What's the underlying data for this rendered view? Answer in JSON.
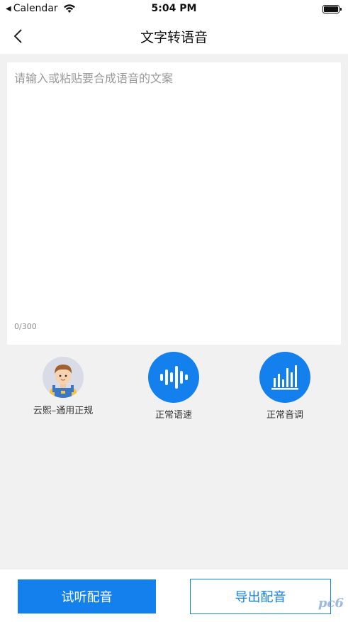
{
  "status_bar": {
    "back_app": "Calendar",
    "time": "5:04 PM"
  },
  "nav": {
    "title": "文字转语音",
    "back_icon": "chevron-left-icon"
  },
  "editor": {
    "placeholder": "请输入或粘贴要合成语音的文案",
    "value": "",
    "char_count": "0/300"
  },
  "options": [
    {
      "label": "云熙–通用正规",
      "icon": "avatar"
    },
    {
      "label": "正常语速",
      "icon": "sound-wave-icon"
    },
    {
      "label": "正常音调",
      "icon": "equalizer-icon"
    }
  ],
  "actions": {
    "preview_label": "试听配音",
    "export_label": "导出配音"
  },
  "watermark": "pc6",
  "colors": {
    "accent": "#1480ee",
    "background": "#f1f1f1"
  }
}
